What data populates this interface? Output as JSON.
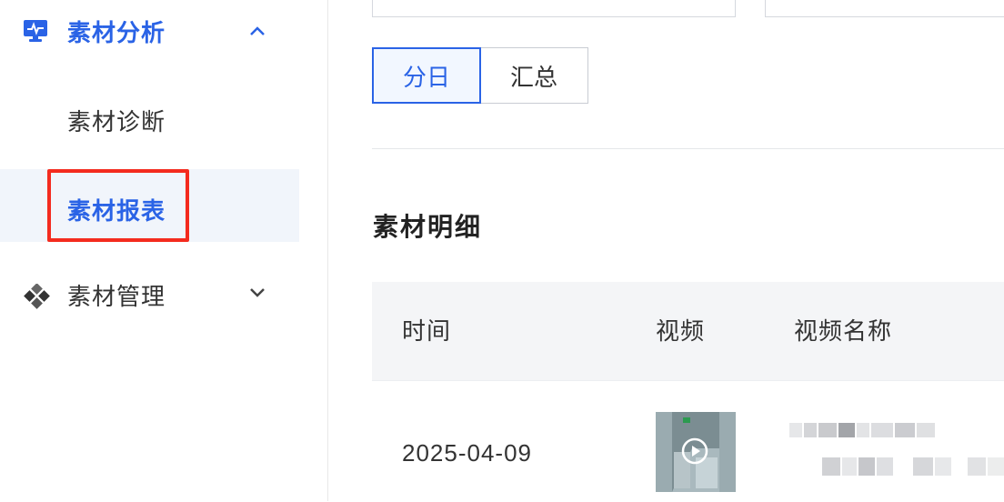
{
  "sidebar": {
    "group_analysis": {
      "label": "素材分析",
      "icon": "monitor-pulse-icon",
      "chevron": "chevron-up-icon"
    },
    "items": [
      {
        "label": "素材诊断"
      },
      {
        "label": "素材报表",
        "active": true
      }
    ],
    "group_manage": {
      "label": "素材管理",
      "icon": "diamond-grid-icon",
      "chevron": "chevron-down-icon"
    }
  },
  "segmented": {
    "options": [
      "分日",
      "汇总"
    ],
    "selected": "分日"
  },
  "section": {
    "title": "素材明细"
  },
  "table": {
    "columns": [
      "时间",
      "视频",
      "视频名称"
    ],
    "rows": [
      {
        "date": "2025-04-09",
        "video": "video-thumbnail",
        "name": ""
      }
    ]
  },
  "colors": {
    "accent": "#2a63e6",
    "highlight": "#f42b1e",
    "active_bg": "#f1f5fb",
    "header_bg": "#f4f5f7"
  }
}
